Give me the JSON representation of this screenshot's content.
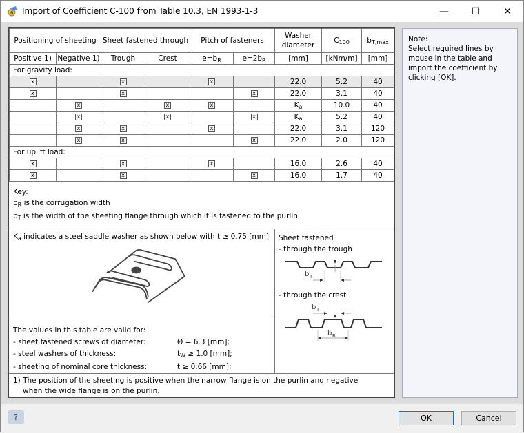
{
  "window": {
    "title": "Import of Coefficient C-100 from Table 10.3, EN 1993-1-3"
  },
  "table": {
    "headers": {
      "positioning": "Positioning of sheeting",
      "fastened": "Sheet fastened through",
      "pitch": "Pitch of fasteners",
      "washer": "Washer diameter",
      "c100": "C",
      "c100_sub": "100",
      "bt": "b",
      "bt_sub": "T,max"
    },
    "subheaders": {
      "positive": "Positive 1)",
      "negative": "Negative 1)",
      "trough": "Trough",
      "crest": "Crest",
      "e1": "e=b",
      "e1_sub": "R",
      "e2": "e=2b",
      "e2_sub": "R",
      "washer_unit": "[mm]",
      "c100_unit": "[kNm/m]",
      "bt_unit": "[mm]"
    },
    "checkbox_mark": "x",
    "groups": [
      {
        "label": "For gravity load:",
        "rows": [
          {
            "checks": [
              1,
              0,
              1,
              0,
              1,
              0
            ],
            "washer": "22.0",
            "c100": "5.2",
            "bt": "40",
            "selected": true
          },
          {
            "checks": [
              1,
              0,
              1,
              0,
              0,
              1
            ],
            "washer": "22.0",
            "c100": "3.1",
            "bt": "40"
          },
          {
            "checks": [
              0,
              1,
              0,
              1,
              1,
              0
            ],
            "washer": "K",
            "washer_sub": "a",
            "c100": "10.0",
            "bt": "40"
          },
          {
            "checks": [
              0,
              1,
              0,
              1,
              0,
              1
            ],
            "washer": "K",
            "washer_sub": "a",
            "c100": "5.2",
            "bt": "40"
          },
          {
            "checks": [
              0,
              1,
              1,
              0,
              1,
              0
            ],
            "washer": "22.0",
            "c100": "3.1",
            "bt": "120"
          },
          {
            "checks": [
              0,
              1,
              1,
              0,
              0,
              1
            ],
            "washer": "22.0",
            "c100": "2.0",
            "bt": "120"
          }
        ]
      },
      {
        "label": "For uplift load:",
        "rows": [
          {
            "checks": [
              1,
              0,
              1,
              0,
              1,
              0
            ],
            "washer": "16.0",
            "c100": "2.6",
            "bt": "40"
          },
          {
            "checks": [
              1,
              0,
              1,
              0,
              0,
              1
            ],
            "washer": "16.0",
            "c100": "1.7",
            "bt": "40"
          }
        ]
      }
    ]
  },
  "key": {
    "title": "Key:",
    "br_sym": "b",
    "br_sub": "R",
    "br_text": " is the corrugation width",
    "bt_sym": "b",
    "bt_sub": "T",
    "bt_text": " is the width of the sheeting flange through which it is fastened to the purlin"
  },
  "ka": {
    "sym": "K",
    "sub": "a",
    "text": " indicates a steel saddle washer as shown below with t ≥ 0.75 [mm]"
  },
  "valid": {
    "title": "The values in this table are valid for:",
    "rows": [
      {
        "label": "- sheet fastened screws of diameter:",
        "value": "Ø = 6.3 [mm];"
      },
      {
        "label": "- steel washers of thickness:",
        "value": "t",
        "sub": "W",
        "value2": " ≥ 1.0 [mm];"
      },
      {
        "label": "- sheeting of nominal core thickness:",
        "value": "t ≥ 0.66 [mm];"
      }
    ]
  },
  "sheet": {
    "title": "Sheet fastened",
    "trough": "- through the trough",
    "crest": "- through the crest",
    "bt": "b",
    "bt_sub": "T",
    "br": "b",
    "br_sub": "R"
  },
  "footnote": {
    "line1": "1) The position of the sheeting is positive when the narrow flange is on the purlin and negative",
    "line2": "when the wide flange is on the purlin."
  },
  "note": {
    "title": "Note:",
    "text": "Select required lines by mouse in the table and import the coefficient by clicking [OK]."
  },
  "buttons": {
    "ok": "OK",
    "cancel": "Cancel",
    "help": "?"
  }
}
